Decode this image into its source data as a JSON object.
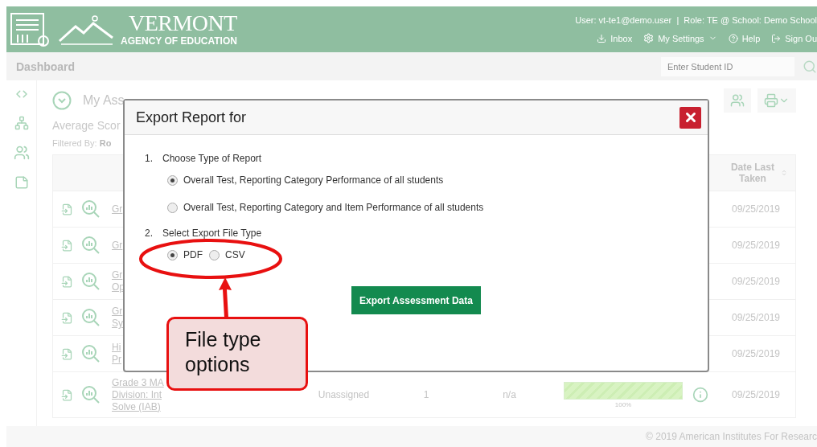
{
  "header": {
    "logo_title": "VERMONT",
    "logo_subtitle": "AGENCY OF EDUCATION",
    "user_line": "User: vt-te1@demo.user  |  Role: TE @ School: Demo School",
    "links": [
      {
        "label": "Inbox",
        "kind": "inbox"
      },
      {
        "label": "My Settings",
        "kind": "settings"
      },
      {
        "label": "Help",
        "kind": "help"
      },
      {
        "label": "Sign Ou",
        "kind": "signout"
      }
    ]
  },
  "breadcrumb": {
    "title": "Dashboard",
    "search": {
      "placeholder": "Enter Student ID"
    }
  },
  "report": {
    "title": "My Ass",
    "subtitle": "Average Scor",
    "filter": "Filtered By: **Ro**"
  },
  "table": {
    "date_header": "Date Last Taken",
    "rows": [
      {
        "name_lines": [
          "Gr"
        ],
        "date": "09/25/2019"
      },
      {
        "name_lines": [
          "Gr"
        ],
        "date": "09/25/2019"
      },
      {
        "name_lines": [
          "Gr",
          "Op"
        ],
        "date": "09/25/2019"
      },
      {
        "name_lines": [
          "Gr",
          "Sy"
        ],
        "date": "09/25/2019"
      },
      {
        "name_lines": [
          "Hi",
          "Pr"
        ],
        "date": "09/25/2019"
      },
      {
        "name_lines": [
          "Grade 3 MA",
          "Division: Int",
          "Solve (IAB)"
        ],
        "status": "Unassigned",
        "count": "1",
        "score": "n/a",
        "level": 1,
        "level_label": "100%",
        "date": "09/25/2019"
      }
    ]
  },
  "modal": {
    "title": "Export Report for",
    "steps": [
      {
        "number": "1.",
        "label": "Choose Type of Report",
        "options": [
          {
            "label": "Overall Test, Reporting Category Performance of all students",
            "selected": true
          },
          {
            "label": "Overall Test, Reporting Category and Item Performance of all students",
            "selected": false
          }
        ],
        "inline": false
      },
      {
        "number": "2.",
        "label": "Select Export File Type",
        "options": [
          {
            "label": "PDF",
            "selected": true
          },
          {
            "label": "CSV",
            "selected": false
          }
        ],
        "inline": true
      }
    ],
    "button": "Export Assessment Data"
  },
  "annotation": {
    "label": "File type options"
  },
  "footer": "© 2019 American Institutes For Researc"
}
